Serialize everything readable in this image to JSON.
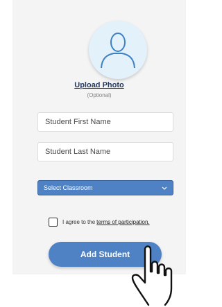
{
  "upload": {
    "label": "Upload Photo",
    "optional": "(Optional)",
    "icon": "avatar-placeholder-icon"
  },
  "form": {
    "first_name_placeholder": "Student First Name",
    "last_name_placeholder": "Student Last Name",
    "classroom_select": "Select Classroom"
  },
  "agreement": {
    "text": "I agree to the",
    "link": "terms of participation."
  },
  "submit_label": "Add Student",
  "colors": {
    "accent": "#4f82c5",
    "panel_bg": "#f4f4f4",
    "avatar_bg": "#e3f1fb",
    "heading": "#263a60"
  }
}
